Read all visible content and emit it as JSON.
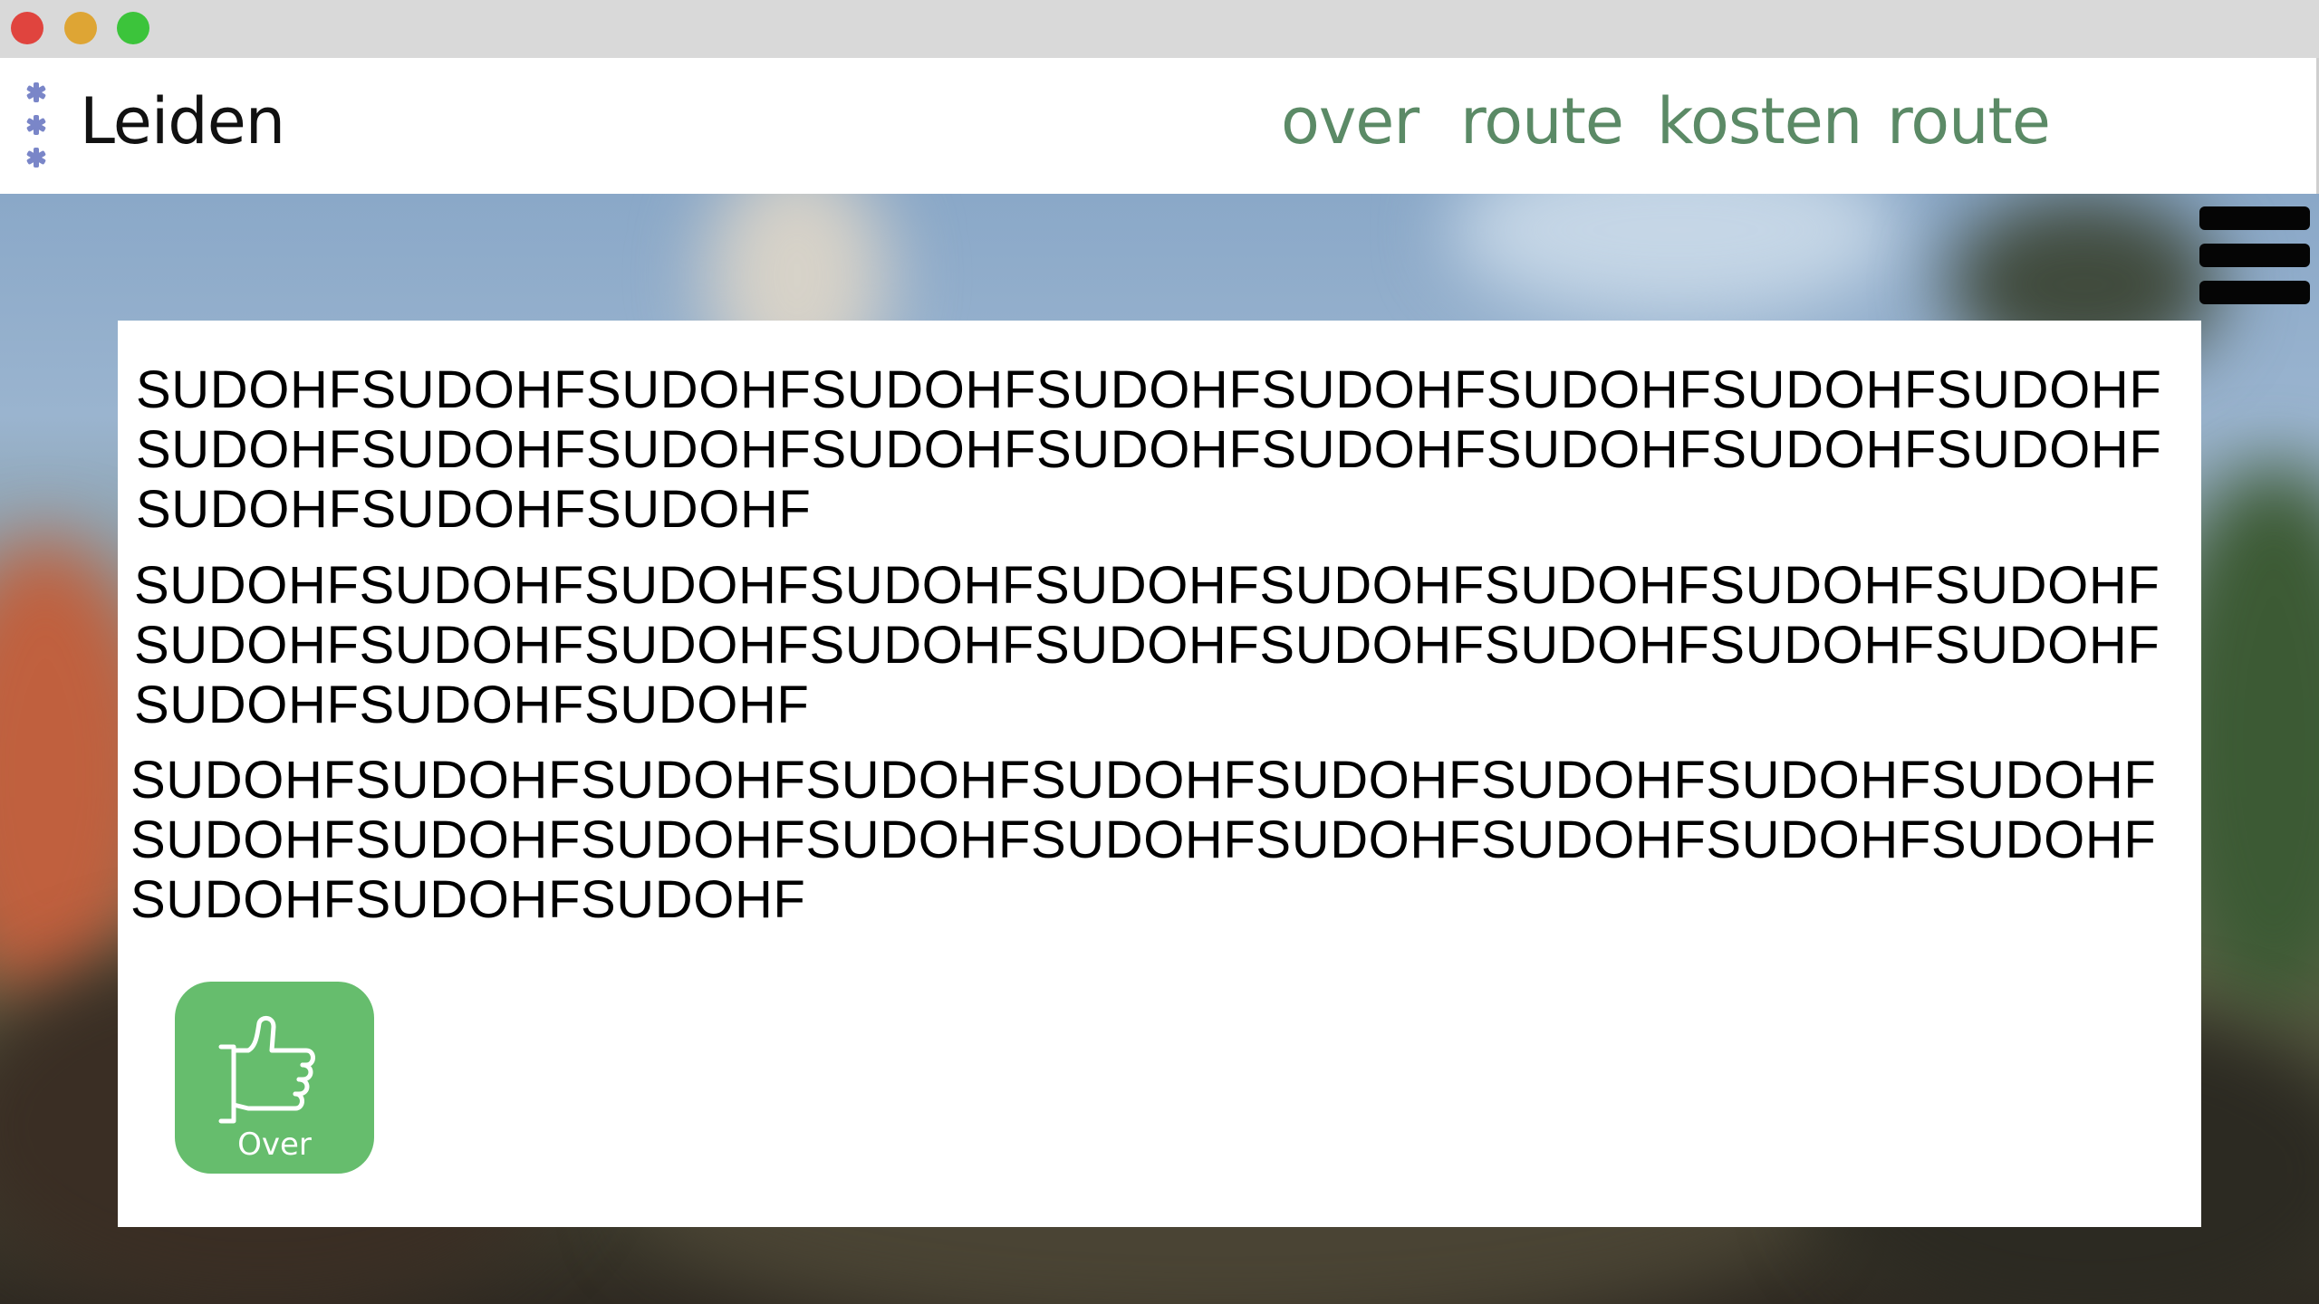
{
  "window": {
    "controls": [
      "close",
      "minimize",
      "maximize"
    ]
  },
  "header": {
    "site_title": "Leiden",
    "logo_icon": "asterisk-stack-icon",
    "nav": [
      {
        "label": "over"
      },
      {
        "label": "route"
      },
      {
        "label": "kosten"
      },
      {
        "label": "route"
      }
    ]
  },
  "menu": {
    "icon": "hamburger-icon"
  },
  "content": {
    "paragraphs": [
      "SUDOHFSUDOHFSUDOHFSUDOHFSUDOHFSUDOHFSUDOHFSUDOHFSUDOHFSUDOHFSUDOHFSUDOHFSUDOHFSUDOHFSUDOHFSUDOHFSUDOHFSUDOHFSUDOHFSUDOHFSUDOHF",
      "SUDOHFSUDOHFSUDOHFSUDOHFSUDOHFSUDOHFSUDOHFSUDOHFSUDOHFSUDOHFSUDOHFSUDOHFSUDOHFSUDOHFSUDOHFSUDOHFSUDOHFSUDOHFSUDOHFSUDOHFSUDOHF",
      "SUDOHFSUDOHFSUDOHFSUDOHFSUDOHFSUDOHFSUDOHFSUDOHFSUDOHFSUDOHFSUDOHFSUDOHFSUDOHFSUDOHFSUDOHFSUDOHFSUDOHFSUDOHFSUDOHFSUDOHFSUDOHF"
    ],
    "over_button": {
      "label": "Over",
      "icon": "thumbs-up-icon"
    }
  },
  "colors": {
    "nav": "#5b8a66",
    "button": "#66bd6d",
    "logo": "#7a86c8",
    "titlebar": "#d9d9d9"
  }
}
